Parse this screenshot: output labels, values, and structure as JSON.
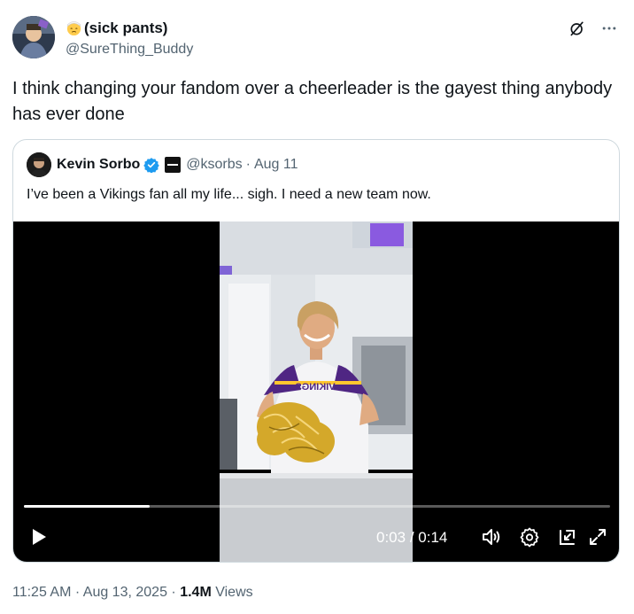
{
  "author": {
    "display_name": "(sick pants)",
    "handle": "@SureThing_Buddy",
    "emoji_icon": "face-with-head-bandage"
  },
  "tweet": {
    "text": "I think changing your fandom over a cheerleader is the gayest thing anybody has ever done"
  },
  "quote": {
    "name": "Kevin Sorbo",
    "handle": "@ksorbs",
    "separator": "·",
    "date": "Aug 11",
    "text": "I’ve been a Vikings fan all my life... sigh. I need a new team now.",
    "verified_icon": "verified-badge-icon",
    "verified_color": "#1d9bf0"
  },
  "video": {
    "current_time": "0:03",
    "time_separator": "/",
    "duration": "0:14",
    "progress_fraction": 0.214,
    "jersey_text": "VIKINGS"
  },
  "meta": {
    "time": "11:25 AM",
    "sep1": "·",
    "date": "Aug 13, 2025",
    "sep2": "·",
    "views_count": "1.4M",
    "views_label": "Views"
  },
  "colors": {
    "text_primary": "#0f1419",
    "text_secondary": "#536471",
    "border": "#cfd9de",
    "vikings_purple": "#4f2683",
    "vikings_gold": "#ffc62f"
  }
}
